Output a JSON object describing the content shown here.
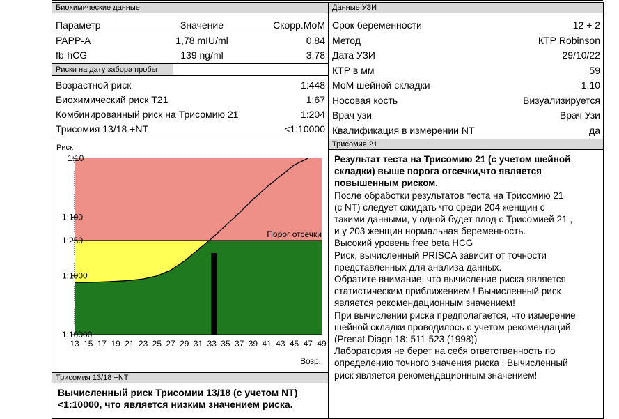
{
  "bio": {
    "header": "Биохимические данные",
    "col_param": "Параметр",
    "col_value": "Значение",
    "col_mom": "Скорр.МоМ",
    "rows": [
      {
        "param": "PAPP-A",
        "value": "1,78 mIU/ml",
        "mom": "0,84"
      },
      {
        "param": "fb-hCG",
        "value": "139 ng/ml",
        "mom": "3,78"
      }
    ]
  },
  "risk": {
    "header": "Риски на дату забора пробы",
    "rows": [
      {
        "label": "Возрастной риск",
        "value": "1:448"
      },
      {
        "label": "Биохимический риск T21",
        "value": "1:67"
      },
      {
        "label": "Комбинированный риск на Трисомию 21",
        "value": "1:204"
      },
      {
        "label": "Трисомия 13/18 +NT",
        "value": "<1:10000"
      }
    ]
  },
  "usi": {
    "header": "Данные УЗИ",
    "rows": [
      {
        "label": "Срок беременности",
        "value": "12 + 2"
      },
      {
        "label": "Метод",
        "value": "КТР Robinson"
      },
      {
        "label": "Дата УЗИ",
        "value": "29/10/22"
      },
      {
        "label": "КТР в мм",
        "value": "59"
      },
      {
        "label": "МоМ шейной складки",
        "value": "1,10"
      },
      {
        "label": "Носовая кость",
        "value": "Визуализируется"
      },
      {
        "label": "Врач узи",
        "value": "Врач Узи"
      },
      {
        "label": "Квалификация в измерении NT",
        "value": "да"
      }
    ]
  },
  "chart": {
    "ylabel": "Риск",
    "xlabel": "Возр.",
    "threshold_label": "Порог отсечки",
    "y_ticks": [
      "1:10",
      "1:100",
      "1:250",
      "1:1000",
      "1:10000"
    ],
    "x_ticks": [
      "13",
      "15",
      "17",
      "19",
      "21",
      "23",
      "25",
      "27",
      "29",
      "31",
      "33",
      "35",
      "37",
      "39",
      "41",
      "43",
      "45",
      "47",
      "49"
    ]
  },
  "chart_data": {
    "type": "line",
    "title": "",
    "xlabel": "Возр.",
    "ylabel": "Риск",
    "x_scale": "linear",
    "y_scale": "log",
    "xlim": [
      13,
      49
    ],
    "ylim_denominators": [
      10,
      10000
    ],
    "threshold_denominator": 250,
    "threshold_label": "Порог отсечки",
    "patient_age_marker": 32,
    "x": [
      13,
      15,
      17,
      19,
      21,
      23,
      25,
      27,
      29,
      31,
      33,
      35,
      37,
      39,
      41,
      43,
      45,
      47
    ],
    "risk_denominator": [
      1300,
      1290,
      1270,
      1240,
      1200,
      1130,
      1000,
      800,
      560,
      360,
      230,
      140,
      85,
      50,
      31,
      20,
      13,
      10
    ],
    "colors": {
      "high_zone": "#ef9088",
      "mid_zone": "#ffff55",
      "low_zone": "#1f7a1f",
      "curve": "#000000",
      "marker": "#000000"
    }
  },
  "t1318": {
    "header": "Трисомия 13/18 +NT",
    "lines": [
      "Вычисленный риск Трисомии 13/18 (с учетом NT)",
      "<1:10000, что является низким значением риска."
    ]
  },
  "t21": {
    "header": "Трисомия 21",
    "bold_lines": [
      "Результат теста на Трисомию 21 (с учетом шейной",
      "складки) выше  порога отсечки,что является",
      "повышенным риском."
    ],
    "lines": [
      "После обработки результатов теста на Трисомию 21",
      "(с NT) следует ожидать что среди 204 женщин с",
      "такими данными, у одной будет плод с Трисомией 21 ,",
      "и у 203 женщин нормальная беременность.",
      "Высокий уровень free beta HCG",
      "Риск, вычисленный PRISCA зависит от точности",
      "представленных для анализа данных.",
      "Обратите внимание, что вычисление риска является",
      "статистическим приближением ! Вычисленный риск",
      "является рекомендационным значением!",
      "При вычислении риска предполагается, что измерение",
      "шейной складки проводилось с учетом рекомендаций",
      "(Prenat Diagn 18: 511-523 (1998))",
      "Лаборатория не берет на себя ответственность по",
      "определению точного значения риска ! Вычисленный",
      "риск является рекомендационным значением!"
    ]
  }
}
